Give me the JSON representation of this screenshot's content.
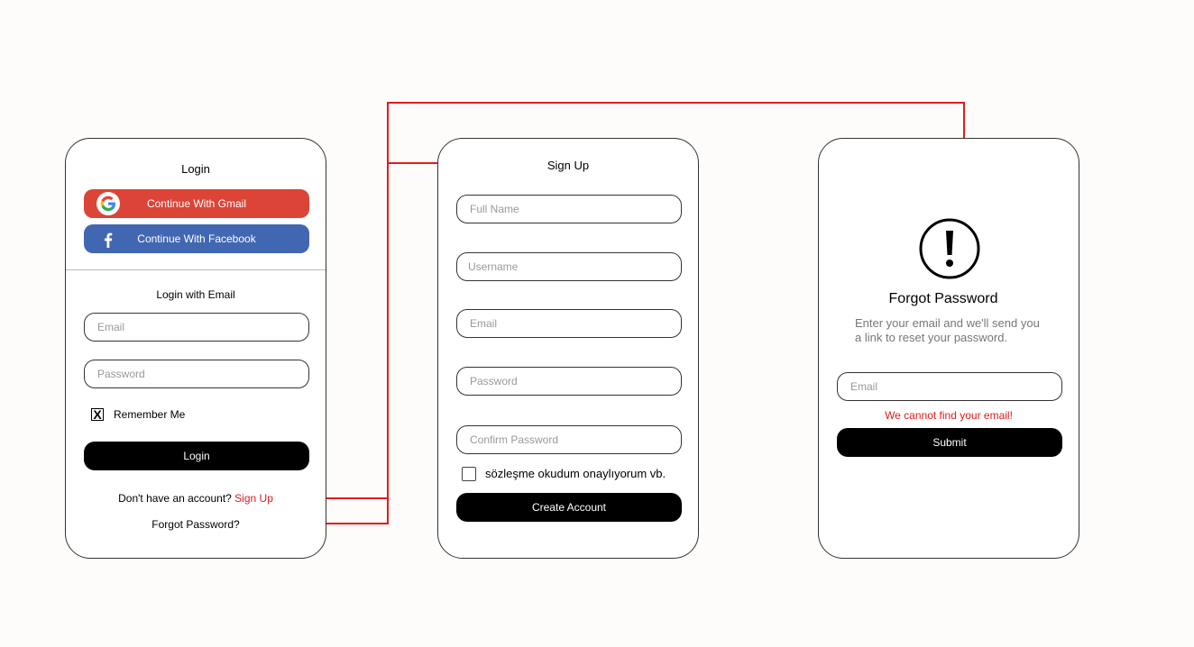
{
  "login": {
    "title": "Login",
    "gmail_button": "Continue With Gmail",
    "facebook_button": "Continue With Facebook",
    "email_section_title": "Login with Email",
    "email_placeholder": "Email",
    "password_placeholder": "Password",
    "remember_checkbox": "X",
    "remember_label": "Remember Me",
    "login_button": "Login",
    "no_account_text": "Don't have an account?",
    "signup_link": "Sign Up",
    "forgot_link": "Forgot Password?"
  },
  "signup": {
    "title": "Sign Up",
    "fullname_placeholder": "Full Name",
    "username_placeholder": "Username",
    "email_placeholder": "Email",
    "password_placeholder": "Password",
    "confirm_placeholder": "Confirm Password",
    "agreement_label": "sözleşme okudum onaylıyorum vb.",
    "create_button": "Create Account"
  },
  "forgot": {
    "icon": "exclamation-icon",
    "title": "Forgot Password",
    "description_line1": "Enter your email and we'll send you",
    "description_line2": "a link to reset your password.",
    "email_placeholder": "Email",
    "error_message": "We cannot find your email!",
    "submit_button": "Submit"
  },
  "colors": {
    "gmail": "#db4437",
    "facebook": "#4267b2",
    "connector": "#e31b1b",
    "link": "#e31b1b"
  }
}
